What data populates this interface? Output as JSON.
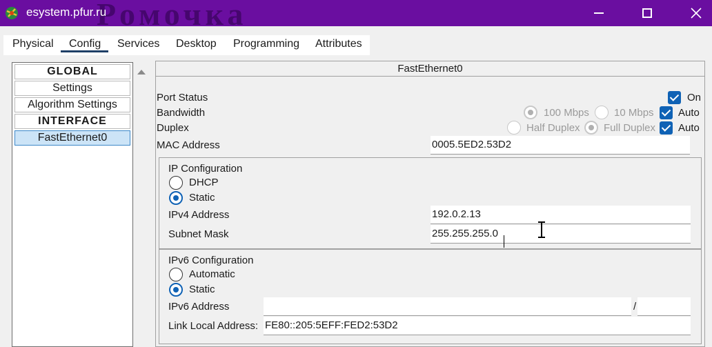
{
  "window": {
    "title": "esystem.pfur.ru",
    "watermark": "Ромочка"
  },
  "tabs": [
    {
      "label": "Physical"
    },
    {
      "label": "Config"
    },
    {
      "label": "Services"
    },
    {
      "label": "Desktop"
    },
    {
      "label": "Programming"
    },
    {
      "label": "Attributes"
    }
  ],
  "active_tab": "Config",
  "sidebar": {
    "items": [
      {
        "label": "GLOBAL",
        "kind": "header"
      },
      {
        "label": "Settings",
        "kind": "item"
      },
      {
        "label": "Algorithm Settings",
        "kind": "item"
      },
      {
        "label": "INTERFACE",
        "kind": "header"
      },
      {
        "label": "FastEthernet0",
        "kind": "item",
        "selected": true
      }
    ]
  },
  "panel": {
    "title": "FastEthernet0",
    "port_status": {
      "label": "Port Status",
      "on_label": "On",
      "checked": true
    },
    "bandwidth": {
      "label": "Bandwidth",
      "opt1": "100 Mbps",
      "opt2": "10 Mbps",
      "auto": "Auto",
      "auto_checked": true
    },
    "duplex": {
      "label": "Duplex",
      "opt1": "Half Duplex",
      "opt2": "Full Duplex",
      "auto": "Auto",
      "auto_checked": true
    },
    "mac": {
      "label": "MAC Address",
      "value": "0005.5ED2.53D2"
    },
    "ipv4": {
      "title": "IP Configuration",
      "dhcp": "DHCP",
      "static": "Static",
      "selected": "Static",
      "address_label": "IPv4 Address",
      "address_value": "192.0.2.13",
      "mask_label": "Subnet Mask",
      "mask_value": "255.255.255.0"
    },
    "ipv6": {
      "title": "IPv6 Configuration",
      "automatic": "Automatic",
      "static": "Static",
      "selected": "Static",
      "address_label": "IPv6 Address",
      "address_value": "",
      "prefix_sep": "/",
      "prefix_value": "",
      "link_local_label": "Link Local Address:",
      "link_local_value": "FE80::205:5EFF:FED2:53D2"
    }
  },
  "colors": {
    "titlebar": "#6a0ea0",
    "accent": "#0f62b5",
    "selected_item": "#cce4f7"
  }
}
